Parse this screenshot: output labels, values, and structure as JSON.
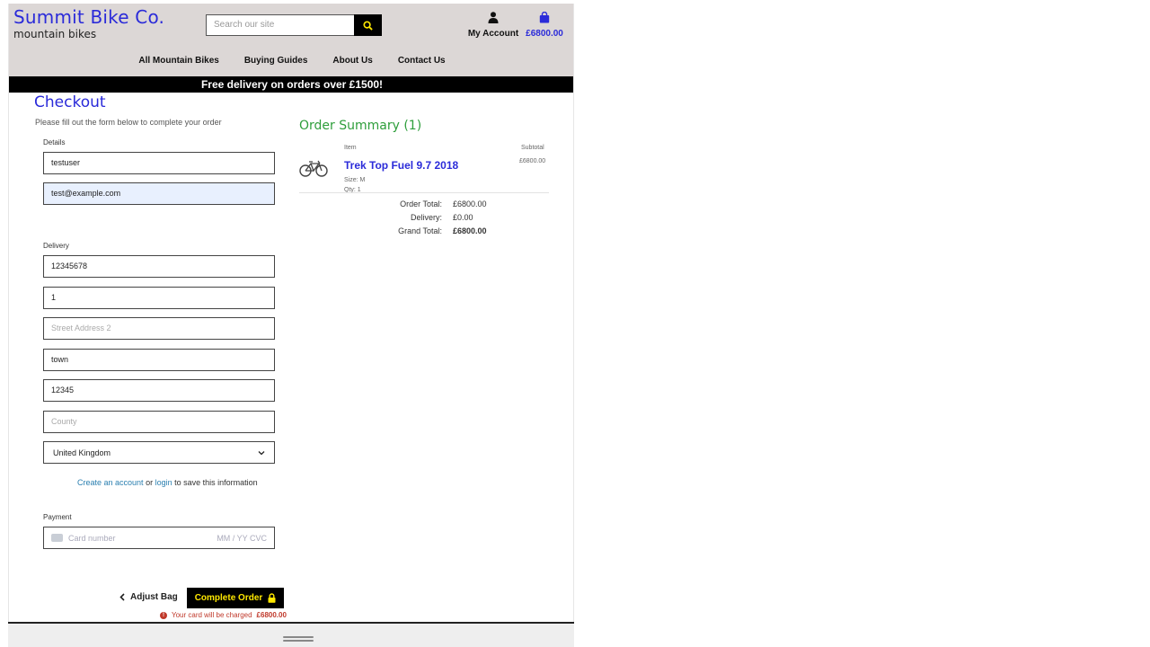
{
  "header": {
    "brand_title": "Summit Bike Co.",
    "brand_subtitle": "mountain bikes",
    "search_placeholder": "Search our site",
    "account_label": "My Account",
    "bag_total": "£6800.00",
    "accent_color": "#2b2bd9"
  },
  "nav": {
    "items": [
      "All Mountain Bikes",
      "Buying Guides",
      "About Us",
      "Contact Us"
    ]
  },
  "promo_banner": "Free delivery on orders over £1500!",
  "checkout": {
    "title": "Checkout",
    "subtitle": "Please fill out the form below to complete your order",
    "details_label": "Details",
    "full_name": "testuser",
    "email": "test@example.com",
    "delivery_label": "Delivery",
    "phone": "12345678",
    "street_address_1": "1",
    "street_address_2_placeholder": "Street Address 2",
    "town": "town",
    "postcode": "12345",
    "county_placeholder": "County",
    "country": "United Kingdom",
    "save_info": {
      "create_account": "Create an account",
      "or": "or",
      "login": "login",
      "rest": "to save this information"
    },
    "payment_label": "Payment",
    "card_placeholder": "Card number",
    "card_exp_placeholder": "MM / YY  CVC",
    "adjust_bag": "Adjust Bag",
    "complete_order": "Complete Order",
    "charge_notice": "Your card will be charged",
    "charge_amount": "£6800.00"
  },
  "summary": {
    "title": "Order Summary (1)",
    "col_item": "Item",
    "col_subtotal": "Subtotal",
    "product": {
      "name": "Trek Top Fuel 9.7 2018",
      "size": "Size: M",
      "qty": "Qty: 1",
      "subtotal": "£6800.00"
    },
    "order_total_label": "Order Total:",
    "order_total": "£6800.00",
    "delivery_label": "Delivery:",
    "delivery": "£0.00",
    "grand_total_label": "Grand Total:",
    "grand_total": "£6800.00"
  }
}
